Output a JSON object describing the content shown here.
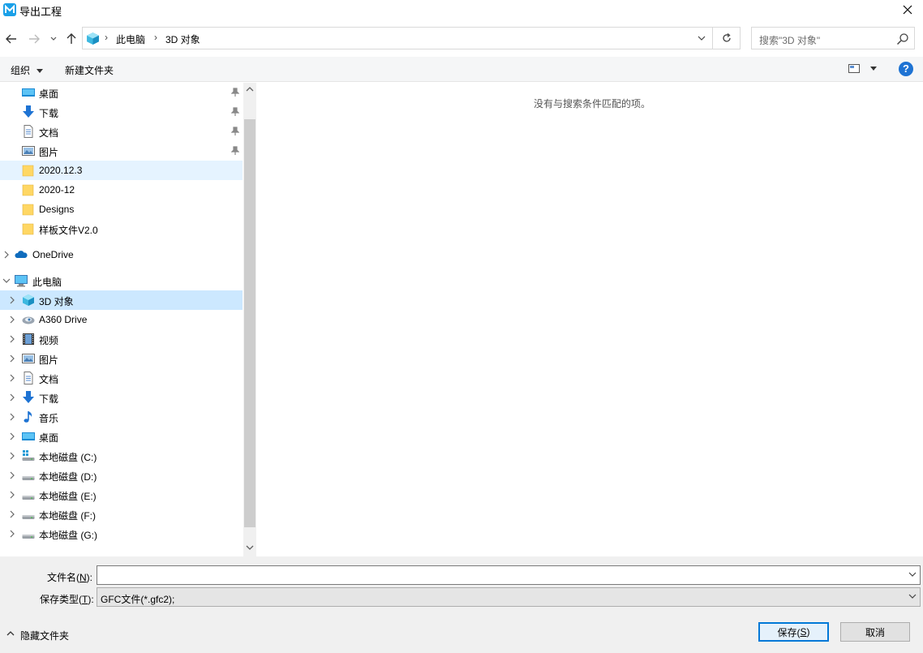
{
  "window": {
    "title": "导出工程"
  },
  "address": {
    "crumbs": [
      "此电脑",
      "3D 对象"
    ]
  },
  "search": {
    "placeholder": "搜索\"3D 对象\""
  },
  "toolbar": {
    "organize": "组织",
    "new_folder": "新建文件夹",
    "help": "?"
  },
  "nav": {
    "quick_access": [
      {
        "label": "桌面",
        "icon": "desktop-icon",
        "pinned": true
      },
      {
        "label": "下载",
        "icon": "download-icon",
        "pinned": true
      },
      {
        "label": "文档",
        "icon": "document-icon",
        "pinned": true
      },
      {
        "label": "图片",
        "icon": "picture-icon",
        "pinned": true
      },
      {
        "label": "2020.12.3",
        "icon": "folder-icon",
        "pinned": false
      },
      {
        "label": "2020-12",
        "icon": "folder-icon",
        "pinned": false
      },
      {
        "label": "Designs",
        "icon": "folder-icon",
        "pinned": false
      },
      {
        "label": "样板文件V2.0",
        "icon": "folder-icon",
        "pinned": false
      }
    ],
    "onedrive": "OneDrive",
    "this_pc": "此电脑",
    "pc_items": [
      {
        "label": "3D 对象",
        "icon": "3d-objects-icon"
      },
      {
        "label": "A360 Drive",
        "icon": "a360-drive-icon"
      },
      {
        "label": "视频",
        "icon": "video-icon"
      },
      {
        "label": "图片",
        "icon": "picture-icon"
      },
      {
        "label": "文档",
        "icon": "document-icon"
      },
      {
        "label": "下载",
        "icon": "download-icon"
      },
      {
        "label": "音乐",
        "icon": "music-icon"
      },
      {
        "label": "桌面",
        "icon": "desktop-icon"
      },
      {
        "label": "本地磁盘 (C:)",
        "icon": "system-drive-icon"
      },
      {
        "label": "本地磁盘 (D:)",
        "icon": "drive-icon"
      },
      {
        "label": "本地磁盘 (E:)",
        "icon": "drive-icon"
      },
      {
        "label": "本地磁盘 (F:)",
        "icon": "drive-icon"
      },
      {
        "label": "本地磁盘 (G:)",
        "icon": "drive-icon"
      }
    ]
  },
  "content": {
    "empty_message": "没有与搜索条件匹配的项。"
  },
  "form": {
    "filename_label_pre": "文件名(",
    "filename_label_key": "N",
    "filename_label_post": "):",
    "filename_value": "",
    "filetype_label_pre": "保存类型(",
    "filetype_label_key": "T",
    "filetype_label_post": "):",
    "filetype_value": "GFC文件(*.gfc2);"
  },
  "footer": {
    "hide_folders": "隐藏文件夹",
    "save_pre": "保存(",
    "save_key": "S",
    "save_post": ")",
    "cancel": "取消"
  },
  "colors": {
    "accent": "#0078d7",
    "selected": "#cce8ff",
    "hover": "#e5f3ff",
    "folder": "#ffd764"
  }
}
